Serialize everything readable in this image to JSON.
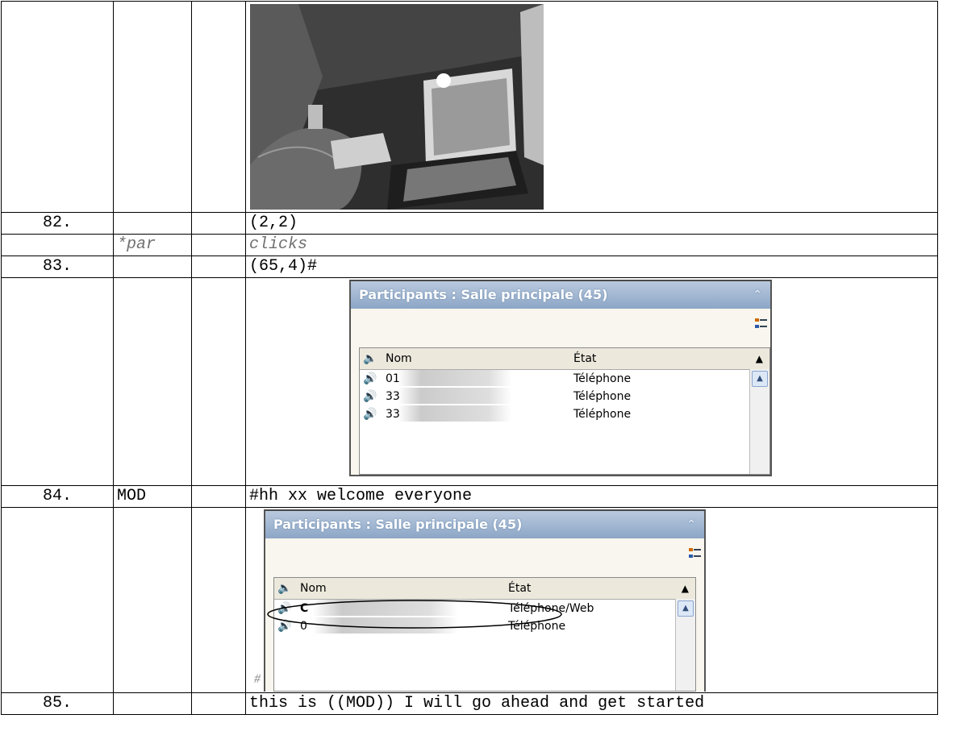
{
  "rows": [
    {
      "num": "",
      "speaker": "",
      "extra": "",
      "content_type": "photo"
    },
    {
      "num": "82.",
      "speaker": "",
      "extra": "",
      "text": "(2,2)"
    },
    {
      "num": "",
      "speaker": "*par",
      "extra": "",
      "text": "clicks"
    },
    {
      "num": "83.",
      "speaker": "",
      "extra": "",
      "text": "(65,4)#"
    },
    {
      "num": "",
      "speaker": "",
      "extra": "",
      "content_type": "panel-1"
    },
    {
      "num": "84.",
      "speaker": "MOD",
      "extra": "",
      "text": "#hh xx welcome everyone"
    },
    {
      "num": "",
      "speaker": "",
      "extra": "",
      "content_type": "panel-2"
    },
    {
      "num": "85.",
      "speaker": "",
      "extra": "",
      "text": "this is ((MOD)) I will go ahead and get started"
    }
  ],
  "panel1": {
    "title": "Participants : Salle principale (45)",
    "col_name": "Nom",
    "col_state": "État",
    "entries": [
      {
        "name": "01",
        "state": "Téléphone"
      },
      {
        "name": "33",
        "state": "Téléphone"
      },
      {
        "name": "33",
        "state": "Téléphone"
      }
    ],
    "marker": "#"
  },
  "panel2": {
    "title": "Participants : Salle principale (45)",
    "col_name": "Nom",
    "col_state": "État",
    "entries": [
      {
        "name": "C",
        "state": "Téléphone/Web"
      },
      {
        "name": "0",
        "state": "Téléphone"
      }
    ],
    "marker": "#"
  },
  "icons": {
    "speaker": "speaker-icon",
    "phone": "phone-speaker-icon",
    "options": "list-options-icon",
    "collapse": "collapse-icon"
  }
}
